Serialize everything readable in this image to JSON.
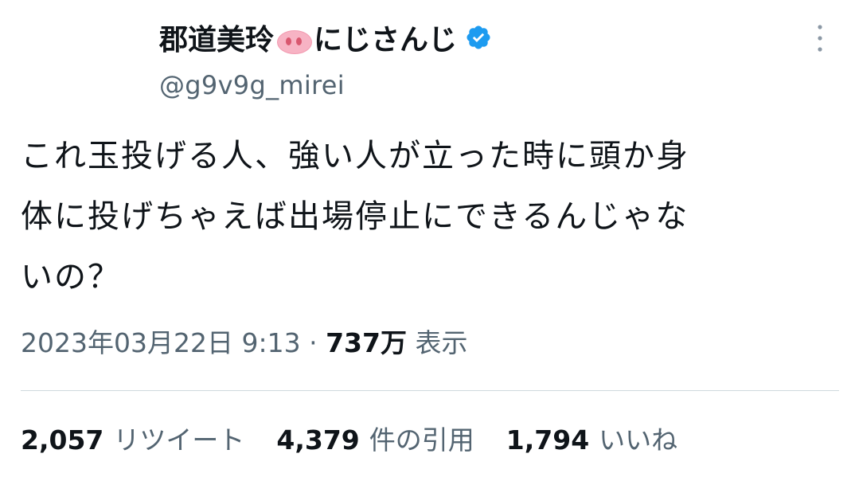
{
  "author": {
    "name_part1": "郡道美玲",
    "name_part2": "にじさんじ",
    "snout_emoji": "pig-nose-icon",
    "handle": "@g9v9g_mirei",
    "verified": true
  },
  "tweet": {
    "lines": [
      "これ玉投げる人、強い人が立った時に頭か身",
      "体に投げちゃえば出場停止にできるんじゃな",
      "いの？"
    ]
  },
  "meta": {
    "timestamp": "2023年03月22日 9:13",
    "separator": "·",
    "views_count": "737万",
    "views_label": "表示"
  },
  "stats": {
    "retweets_count": "2,057",
    "retweets_label": "リツイート",
    "quotes_count": "4,379",
    "quotes_label": "件の引用",
    "likes_count": "1,794",
    "likes_label": "いいね"
  },
  "colors": {
    "text_primary": "#0f1419",
    "text_secondary": "#536471",
    "verified_blue": "#1d9bf0",
    "divider": "#cfd9de"
  }
}
